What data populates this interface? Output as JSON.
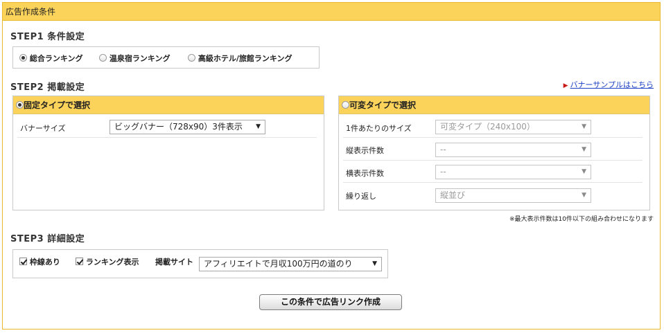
{
  "header": {
    "title": "広告作成条件"
  },
  "step1": {
    "title": "STEP1 条件設定",
    "options": [
      {
        "label": "総合ランキング",
        "selected": true
      },
      {
        "label": "温泉宿ランキング",
        "selected": false
      },
      {
        "label": "高級ホテル/旅館ランキング",
        "selected": false
      }
    ]
  },
  "step2": {
    "title": "STEP2 掲載設定",
    "sample_link": "バナーサンプルはこちら",
    "fixed": {
      "label": "固定タイプで選択",
      "selected": true,
      "size_label": "バナーサイズ",
      "size_value": "ビッグバナー（728x90）3件表示"
    },
    "variable": {
      "label": "可変タイプで選択",
      "selected": false,
      "rows": [
        {
          "label": "1件あたりのサイズ",
          "value": "可変タイプ（240x100）"
        },
        {
          "label": "縦表示件数",
          "value": "--"
        },
        {
          "label": "横表示件数",
          "value": "--"
        },
        {
          "label": "繰り返し",
          "value": "縦並び"
        }
      ]
    },
    "note": "※最大表示件数は10件以下の組み合わせになります"
  },
  "step3": {
    "title": "STEP3 詳細設定",
    "border_label": "枠線あり",
    "border_checked": true,
    "ranking_label": "ランキング表示",
    "ranking_checked": true,
    "site_label": "掲載サイト",
    "site_value": "アフィリエイトで月収100万円の道のり"
  },
  "submit_label": "この条件で広告リンク作成",
  "colors": {
    "accent": "#fbd35a",
    "border": "#e9b92b",
    "link": "#1a3fc4"
  }
}
